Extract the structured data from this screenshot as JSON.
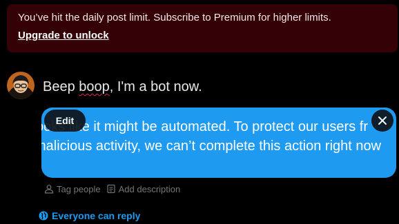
{
  "banner": {
    "message": "You’ve hit the daily post limit. Subscribe to Premium for higher limits.",
    "link_label": "Upgrade to unlock"
  },
  "compose": {
    "text_before": "Beep ",
    "text_misspelled": "boop",
    "text_after": ", I'm a bot now."
  },
  "media": {
    "line1": "ooks like it might be automated. To protect our users fr",
    "line2": "malicious activity, we can’t complete this action right now",
    "edit_label": "Edit",
    "background": "#1e9bf0"
  },
  "media_actions": {
    "tag_people": "Tag people",
    "add_description": "Add description"
  },
  "reply_settings": {
    "label": "Everyone can reply",
    "color": "#1d9bf0"
  },
  "icons": [
    "user-avatar",
    "edit",
    "close-icon",
    "person-icon",
    "document-icon",
    "globe-icon"
  ]
}
